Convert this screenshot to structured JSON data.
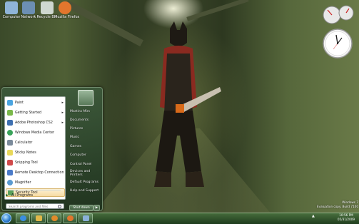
{
  "desktop": {
    "icons": [
      {
        "label": "Computer",
        "icon": "computer-icon",
        "color": "#8fb4d8"
      },
      {
        "label": "Network",
        "icon": "network-icon",
        "color": "#6c8fb3"
      },
      {
        "label": "Recycle Bin",
        "icon": "recycle-bin-icon",
        "color": "#cfd8d0"
      },
      {
        "label": "Mozilla Firefox",
        "icon": "firefox-icon",
        "color": "#e2762d"
      }
    ],
    "watermark_line1": "Windows 7",
    "watermark_line2": "Evaluation copy. Build 7100"
  },
  "start_menu": {
    "programs": [
      {
        "label": "Paint",
        "icon": "paint-icon",
        "color": "#4aa4e0",
        "has_submenu": true
      },
      {
        "label": "Getting Started",
        "icon": "getting-started-icon",
        "color": "#7ab84a",
        "has_submenu": true
      },
      {
        "label": "Adobe Photoshop CS2",
        "icon": "photoshop-icon",
        "color": "#3d6fb0",
        "has_submenu": true
      },
      {
        "label": "Windows Media Center",
        "icon": "media-center-icon",
        "color": "#3aa35a",
        "has_submenu": false
      },
      {
        "label": "Calculator",
        "icon": "calculator-icon",
        "color": "#7a8a9a",
        "has_submenu": false
      },
      {
        "label": "Sticky Notes",
        "icon": "sticky-notes-icon",
        "color": "#e8d85a",
        "has_submenu": false
      },
      {
        "label": "Snipping Tool",
        "icon": "snipping-tool-icon",
        "color": "#d04a4a",
        "has_submenu": false
      },
      {
        "label": "Remote Desktop Connection",
        "icon": "remote-desktop-icon",
        "color": "#4a7ac8",
        "has_submenu": false
      },
      {
        "label": "Magnifier",
        "icon": "magnifier-icon",
        "color": "#5a9ad0",
        "has_submenu": false
      },
      {
        "label": "Security Tool",
        "icon": "security-tool-icon",
        "color": "#5aa05a",
        "has_submenu": false,
        "selected": true
      }
    ],
    "all_programs": "All Programs",
    "search_placeholder": "Search programs and files",
    "right_items": [
      "Martins Mirs",
      "Documents",
      "Pictures",
      "Music",
      "Games",
      "Computer",
      "Control Panel",
      "Devices and Printers",
      "Default Programs",
      "Help and Support"
    ],
    "shutdown_label": "Shut down",
    "shutdown_arrow": "▶"
  },
  "taskbar": {
    "pinned": [
      {
        "icon": "internet-explorer-icon",
        "color": "#3a8ee0"
      },
      {
        "icon": "windows-explorer-icon",
        "color": "#e0b84a"
      },
      {
        "icon": "media-player-icon",
        "color": "#e08a2a"
      },
      {
        "icon": "firefox-icon",
        "color": "#e2762d"
      },
      {
        "icon": "window-icon",
        "color": "#8ab0d8"
      }
    ],
    "tray_arrow": "▲",
    "time": "10:56 PM",
    "date": "05/31/2009"
  }
}
